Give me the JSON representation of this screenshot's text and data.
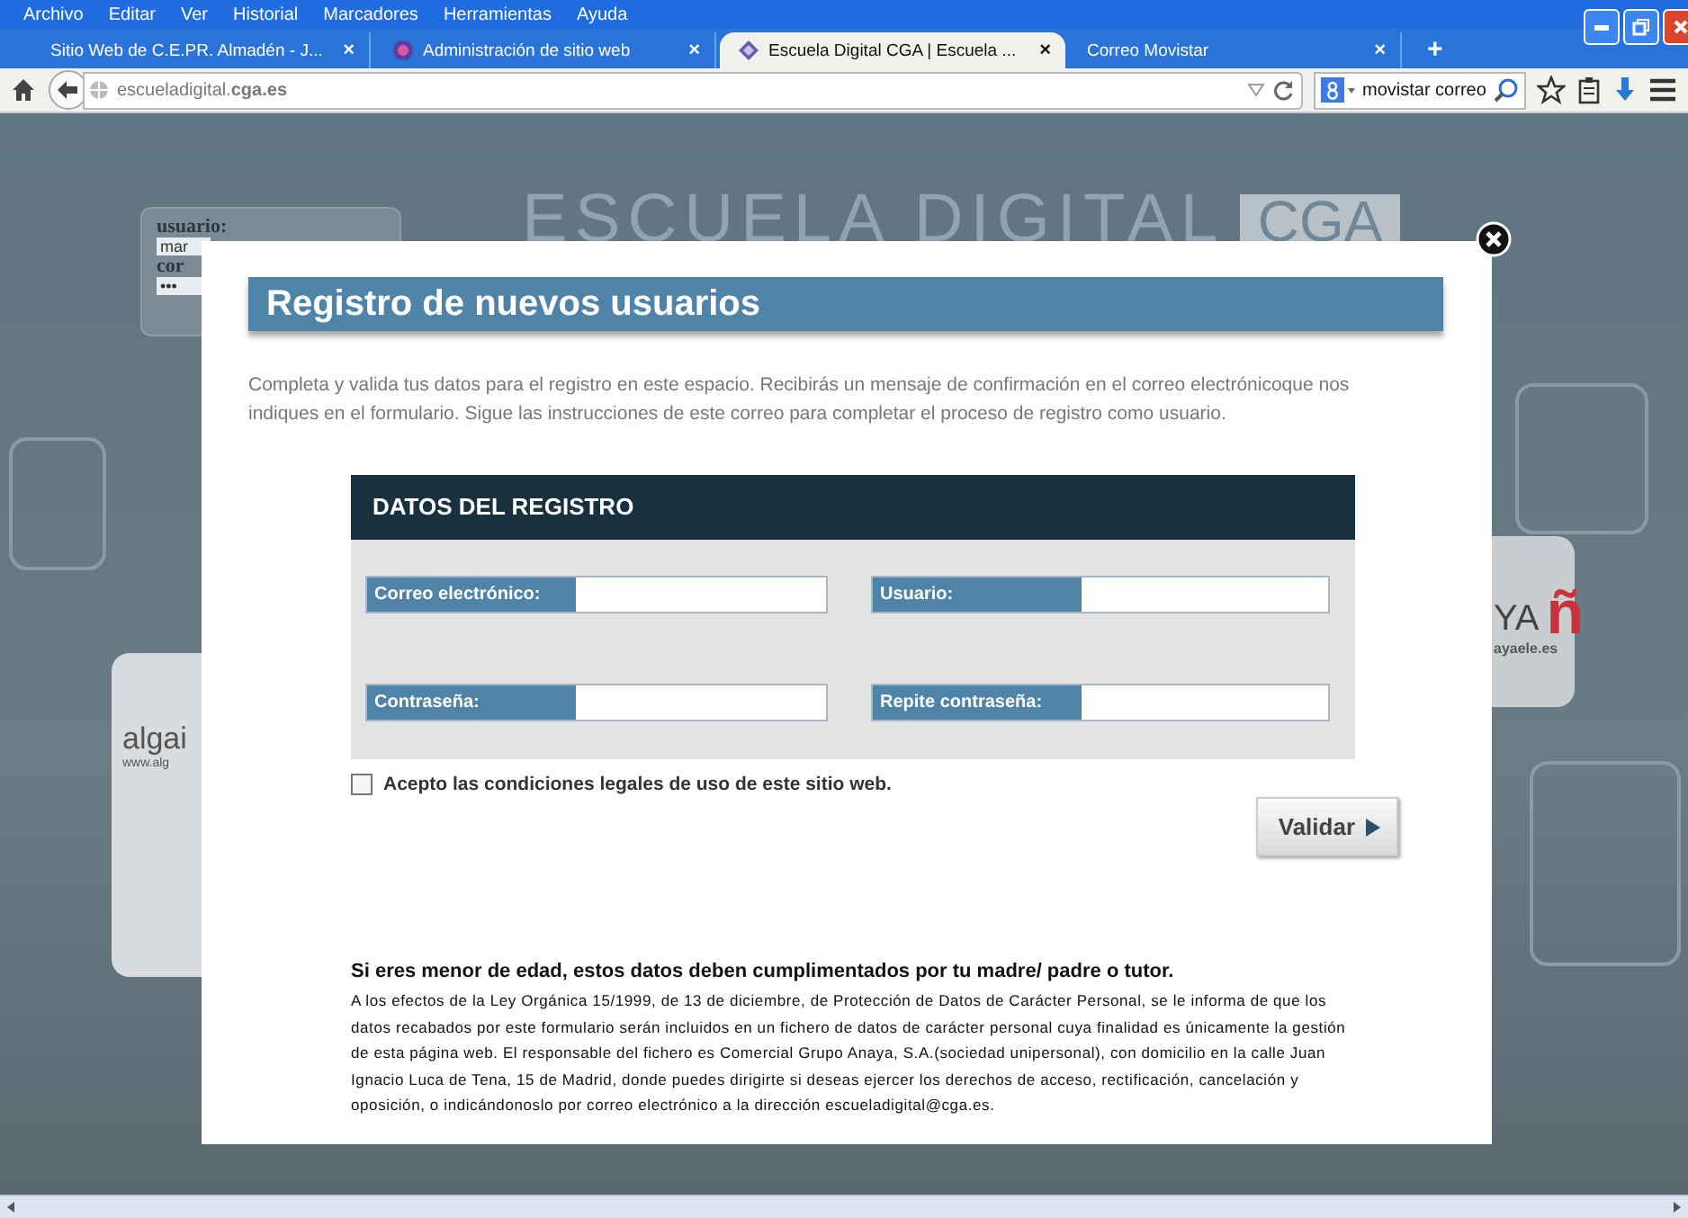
{
  "menu_bar": [
    "Archivo",
    "Editar",
    "Ver",
    "Historial",
    "Marcadores",
    "Herramientas",
    "Ayuda"
  ],
  "tabs": [
    {
      "label": "Sitio Web de C.E.PR. Almadén - J...",
      "close": "×",
      "selected": false
    },
    {
      "label": "Administración de sitio web",
      "close": "×",
      "selected": false
    },
    {
      "label": "Escuela Digital CGA | Escuela ...",
      "close": "×",
      "selected": true
    },
    {
      "label": "Correo Movistar",
      "close": "×",
      "selected": false
    }
  ],
  "new_tab": "+",
  "address_bar": {
    "url": "escueladigital.**cga.es**"
  },
  "search": {
    "value": "movistar correo"
  },
  "site": {
    "login_user_label": "usuario:",
    "login_user_value": "mar",
    "login_pass_label": "cor",
    "login_pass_value": "•••",
    "logo_text": "ESCUELA DIGITAL",
    "logo_badge": "CGA",
    "ad_left_text": "algai",
    "ad_left_url": "www.alg",
    "ad_right_text": "YA",
    "ad_right_letter": "ñ",
    "ad_right_url": "ayaele.es"
  },
  "dialog": {
    "title": "Registro de nuevos usuarios",
    "intro": "Completa y valida tus datos para el registro en este espacio. Recibirás un mensaje de confirmación en el correo electrónicoque nos indiques en el formulario. Sigue las instrucciones de este correo para completar el proceso de registro como usuario.",
    "form": {
      "header": "DATOS DEL REGISTRO",
      "fields": [
        {
          "label": "Correo electrónico:"
        },
        {
          "label": "Usuario:"
        },
        {
          "label": "Contraseña:"
        },
        {
          "label": "Repite contraseña:"
        }
      ]
    },
    "terms": {
      "label": "Acepto las condiciones legales de uso de este sitio web.",
      "checked": false
    },
    "submit": "Validar",
    "note_heading": "Si eres menor de edad, estos datos deben cumplimentados por tu madre/ padre o tutor.",
    "note_text": "A los efectos de la Ley Orgánica 15/1999, de 13 de diciembre, de Protección de Datos de Carácter Personal, se le informa de que los datos recabados por este formulario serán incluidos en un fichero de datos de carácter personal cuya finalidad es únicamente la gestión de esta página web. El responsable del fichero es Comercial Grupo Anaya, S.A.(sociedad unipersonal), con domicilio en la calle Juan Ignacio Luca de Tena, 15 de Madrid, donde puedes dirigirte si deseas ejercer los derechos de acceso, rectificación, cancelación y oposición, o indicándonoslo por correo electrónico a la dirección escueladigital@cga.es."
  }
}
